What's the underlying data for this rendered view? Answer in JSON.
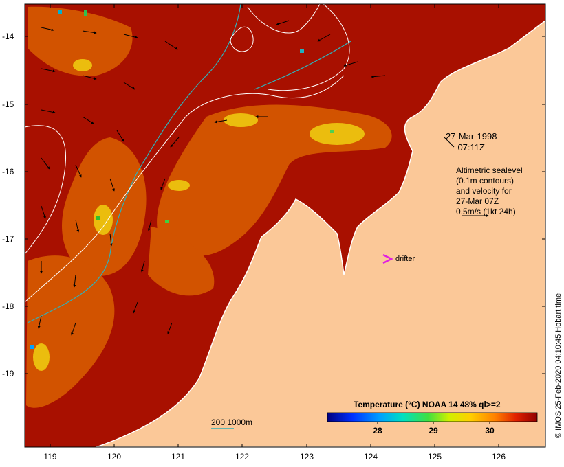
{
  "map": {
    "date": "27-Mar-1998",
    "time": "07:11Z",
    "info_lines": [
      "Altimetric sealevel",
      "(0.1m contours)",
      "and velocity for",
      "27-Mar 07Z",
      "0.5m/s (1kt 24h)"
    ],
    "drifter_label": "drifter",
    "depth_label": "200  1000m",
    "legend_title": "Temperature (°C) NOAA 14 48% ql>=2",
    "colorbar_ticks": [
      "28",
      "29",
      "30"
    ],
    "credit": "© IMOS 25-Feb-2020 04:10:45 Hobart time",
    "lat_labels": [
      "-14",
      "-15",
      "-16",
      "-17",
      "-18",
      "-19"
    ],
    "lon_labels": [
      "119",
      "120",
      "121",
      "122",
      "123",
      "124",
      "125",
      "126"
    ],
    "colors": {
      "sea": "#a81000",
      "land": "#fbc898",
      "warm_patch": "#e06a00",
      "cool_patch": "#f0d010",
      "sealevel_contour": "#ffffff",
      "bathymetry_contour": "#30b0b8",
      "drifter": "#e020e0"
    }
  }
}
